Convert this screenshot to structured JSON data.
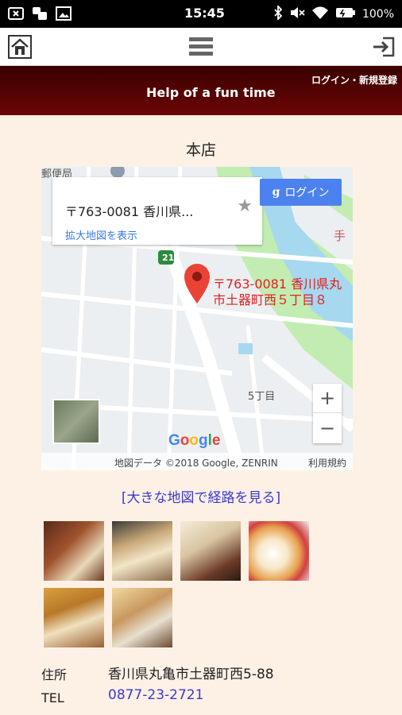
{
  "statusbar": {
    "time": "15:45",
    "battery": "100%",
    "icons": [
      "close-box-icon",
      "chat-icon",
      "image-icon",
      "bluetooth-icon",
      "mute-icon",
      "wifi-icon",
      "battery-icon"
    ]
  },
  "nav": {
    "icons": [
      "home-icon",
      "menu-icon",
      "login-arrow-icon"
    ]
  },
  "banner": {
    "title": "Help of a fun time",
    "login": "ログイン・新規登録"
  },
  "section": {
    "title": "本店"
  },
  "map": {
    "card_address": "〒763-0081 香川県...",
    "card_link": "拡大地図を表示",
    "google_login": "ログイン",
    "pin_label_line1": "〒763-0081 香川県丸",
    "pin_label_line2": "市土器町西５丁目８",
    "place_post": "郵便局",
    "place_district": "5丁目",
    "place_right": "手",
    "route_marker": "21",
    "google_logo": "Google",
    "credit": "地図データ ©2018 Google, ZENRIN",
    "terms": "利用規約",
    "colors": {
      "river": "#a6d8f0",
      "park": "#c3ecb2",
      "pin": "#ea4335"
    }
  },
  "route_link": "[大きな地図で経路を見る]",
  "photos": [
    "shop-exterior-photo",
    "shop-interior-photo",
    "display-case-photo",
    "fruit-cake-photo",
    "pastry-tray-photo",
    "shop-decor-photo"
  ],
  "info": {
    "address_label": "住所",
    "address_value": "香川県丸亀市土器町西5-88",
    "tel_label": "TEL",
    "tel_value": "0877-23-2721"
  }
}
